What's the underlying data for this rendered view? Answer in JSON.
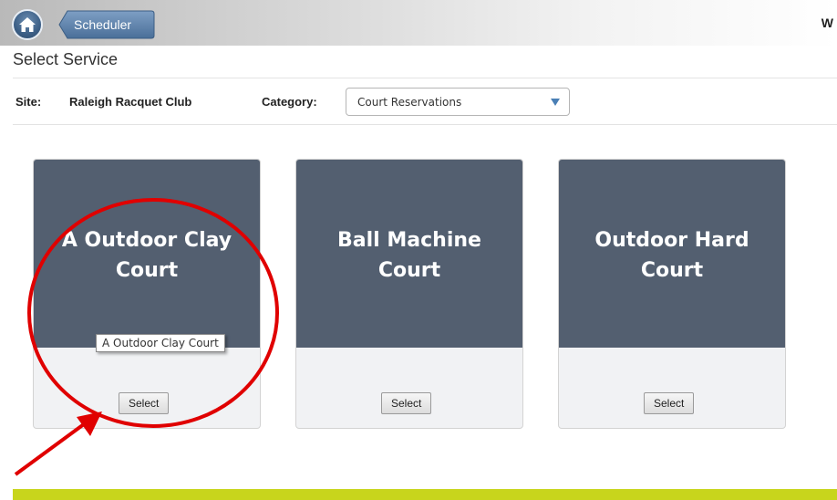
{
  "header": {
    "breadcrumb_label": "Scheduler",
    "welcome_text": "W"
  },
  "page": {
    "title": "Select Service"
  },
  "filters": {
    "site_label": "Site:",
    "site_value": "Raleigh Racquet Club",
    "category_label": "Category:",
    "category_value": "Court Reservations"
  },
  "services": [
    {
      "title": "A Outdoor Clay Court",
      "button": "Select"
    },
    {
      "title": "Ball Machine Court",
      "button": "Select"
    },
    {
      "title": "Outdoor Hard Court",
      "button": "Select"
    }
  ],
  "tooltip": {
    "text": "A Outdoor Clay Court"
  },
  "colors": {
    "card_header": "#535f70",
    "annotation": "#e00000",
    "footer_bar": "#c8d51c",
    "home_button": "#3c5f86"
  },
  "icons": [
    "home-icon",
    "dropdown-arrow-icon"
  ]
}
